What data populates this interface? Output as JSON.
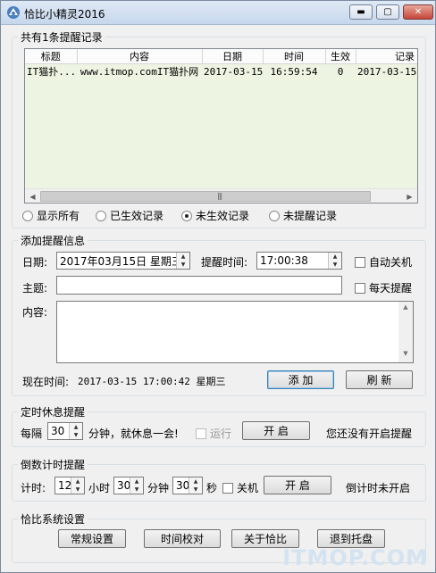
{
  "window": {
    "title": "恰比小精灵2016",
    "minimize": "▬",
    "maximize": "▢",
    "close": "✕"
  },
  "records": {
    "legend": "共有1条提醒记录",
    "columns": [
      "标题",
      "内容",
      "日期",
      "时间",
      "生效",
      "记录"
    ],
    "rows": [
      [
        "IT猫扑...",
        "www.itmop.comIT猫扑网",
        "2017-03-15",
        "16:59:54",
        "0",
        "2017-03-15"
      ]
    ],
    "filters": [
      {
        "label": "显示所有",
        "selected": false
      },
      {
        "label": "已生效记录",
        "selected": false
      },
      {
        "label": "未生效记录",
        "selected": true
      },
      {
        "label": "未提醒记录",
        "selected": false
      }
    ],
    "scroll_left": "◀",
    "scroll_right": "▶",
    "grip": "|||"
  },
  "add": {
    "legend": "添加提醒信息",
    "date_label": "日期:",
    "date_value": "2017年03月15日 星期三",
    "time_label": "提醒时间:",
    "time_value": "17:00:38",
    "auto_shutdown": "自动关机",
    "subject_label": "主题:",
    "subject_value": "",
    "daily": "每天提醒",
    "content_label": "内容:",
    "content_value": "",
    "now_label": "现在时间:",
    "now_value": "2017-03-15 17:00:42 星期三",
    "add_button": "添 加",
    "refresh_button": "刷 新"
  },
  "rest": {
    "legend": "定时休息提醒",
    "every": "每隔",
    "minutes": "30",
    "suffix": "分钟，就休息一会!",
    "run": "运行",
    "start_button": "开 启",
    "status": "您还没有开启提醒"
  },
  "countdown": {
    "legend": "倒数计时提醒",
    "timer_label": "计时:",
    "hours": "12",
    "hours_unit": "小时",
    "mins": "30",
    "mins_unit": "分钟",
    "secs": "30",
    "secs_unit": "秒",
    "shutdown": "关机",
    "start_button": "开 启",
    "status": "倒计时未开启"
  },
  "system": {
    "legend": "恰比系统设置",
    "buttons": [
      "常规设置",
      "时间校对",
      "关于恰比",
      "退到托盘"
    ]
  },
  "watermark": "ITMOP.COM",
  "colors": {
    "list_bg": "#eef4e2",
    "titlebar": "#c6d7ec",
    "close": "#c5453a"
  }
}
